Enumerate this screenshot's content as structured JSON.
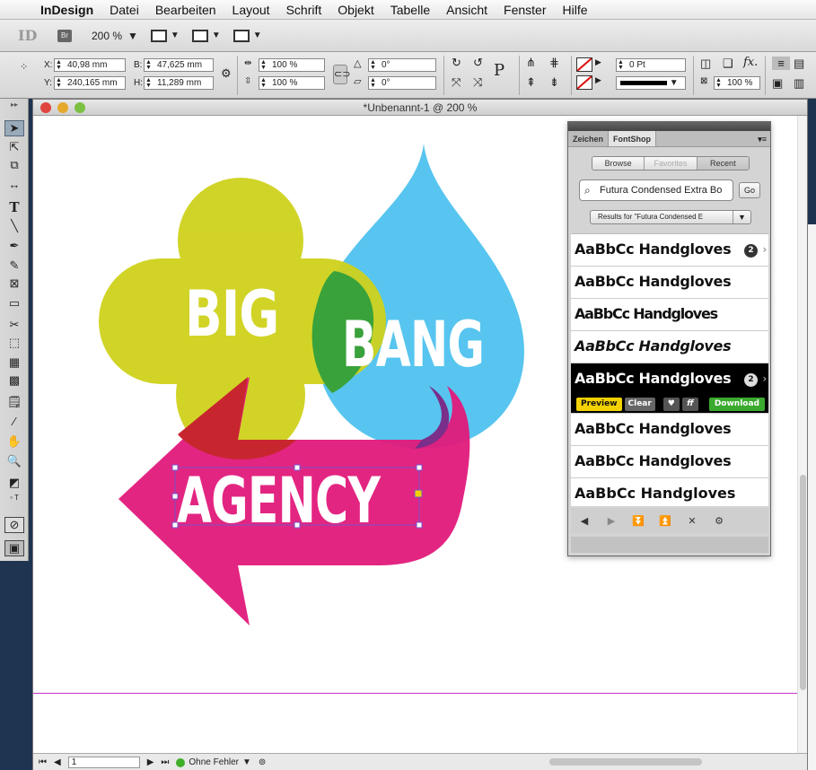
{
  "menubar": {
    "apple": "",
    "app": "InDesign",
    "items": [
      "Datei",
      "Bearbeiten",
      "Layout",
      "Schrift",
      "Objekt",
      "Tabelle",
      "Ansicht",
      "Fenster",
      "Hilfe"
    ]
  },
  "appbar": {
    "id_label": "ID",
    "bridge_label": "Br",
    "zoom": "200 %"
  },
  "control": {
    "x_label": "X:",
    "x_value": "40,98 mm",
    "y_label": "Y:",
    "y_value": "240,165 mm",
    "b_label": "B:",
    "b_value": "47,625 mm",
    "h_label": "H:",
    "h_value": "11,289 mm",
    "scale_x": "100 %",
    "scale_y": "100 %",
    "angle1": "0°",
    "angle2": "0°",
    "stroke_weight": "0 Pt",
    "opacity": "100 %",
    "p_glyph": "P"
  },
  "document": {
    "title": "*Unbenannt-1 @ 200 %",
    "page": "1",
    "preflight": "Ohne Fehler"
  },
  "artwork": {
    "word1": "BIG",
    "word2": "BANG",
    "word3": "AGENCY",
    "colors": {
      "yellow": "#cfd21c",
      "cyan": "#3fbcec",
      "magenta": "#e1177a",
      "green": "#3aa23a",
      "red": "#c8262f",
      "purple": "#7a2f8a"
    }
  },
  "fontshop": {
    "tab_zeichen": "Zeichen",
    "tab_fontshop": "FontShop",
    "seg_browse": "Browse",
    "seg_favorites": "Favorites",
    "seg_recent": "Recent",
    "search_value": "Futura Condensed Extra Bo",
    "go": "Go",
    "results": "Results for \"Futura Condensed E",
    "rows": [
      {
        "sample": "AaBbCc Handgloves",
        "badge": "2"
      },
      {
        "sample": "AaBbCc Handgloves",
        "badge": ""
      },
      {
        "sample": "AaBbCc Handgloves",
        "badge": ""
      },
      {
        "sample": "AaBbCc Handgloves",
        "badge": ""
      },
      {
        "sample": "AaBbCc Handgloves",
        "badge": "2"
      },
      {
        "sample": "AaBbCc Handgloves",
        "badge": ""
      },
      {
        "sample": "AaBbCc Handgloves",
        "badge": ""
      },
      {
        "sample": "AaBbCc Handgloves",
        "badge": ""
      }
    ],
    "btn_preview": "Preview",
    "btn_clear": "Clear",
    "btn_heart": "♥",
    "btn_ff": "ff",
    "btn_download": "Download"
  }
}
